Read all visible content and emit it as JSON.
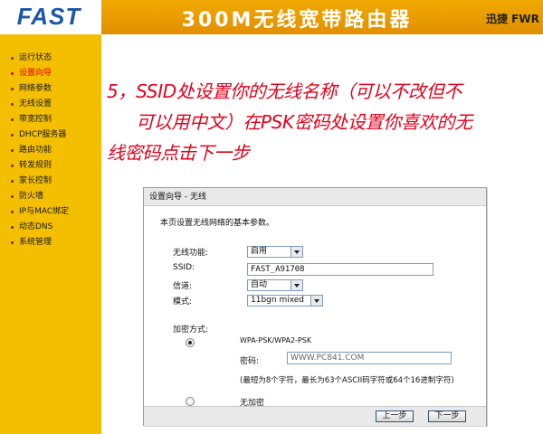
{
  "header": {
    "logo_text": "FAST",
    "router_title": "300M无线宽带路由器",
    "brand_slogan": "迅捷 FWR"
  },
  "sidebar": {
    "items": [
      {
        "label": "运行状态",
        "active": false
      },
      {
        "label": "设置向导",
        "active": true
      },
      {
        "label": "网络参数",
        "active": false
      },
      {
        "label": "无线设置",
        "active": false
      },
      {
        "label": "带宽控制",
        "active": false
      },
      {
        "label": "DHCP服务器",
        "active": false
      },
      {
        "label": "路由功能",
        "active": false
      },
      {
        "label": "转发规则",
        "active": false
      },
      {
        "label": "家长控制",
        "active": false
      },
      {
        "label": "防火墙",
        "active": false
      },
      {
        "label": "IP与MAC绑定",
        "active": false
      },
      {
        "label": "动态DNS",
        "active": false
      },
      {
        "label": "系统管理",
        "active": false
      }
    ]
  },
  "instruction": {
    "line1": "5，SSID处设置你的无线名称（可以不改但不",
    "line2": "可以用中文）在PSK密码处设置你喜欢的无",
    "line3": "线密码点击下一步"
  },
  "dialog": {
    "title": "设置向导 - 无线",
    "description": "本页设置无线网络的基本参数。",
    "wireless_function": {
      "label": "无线功能:",
      "value": "启用"
    },
    "ssid": {
      "label": "SSID:",
      "value": "FAST_A91708"
    },
    "channel": {
      "label": "信道:",
      "value": "自动"
    },
    "mode": {
      "label": "模式:",
      "value": "11bgn mixed"
    },
    "encryption": {
      "label": "加密方式:",
      "wpa_option": "WPA-PSK/WPA2-PSK",
      "wpa_selected": true,
      "password_label": "密码:",
      "password_value": "WWW.PC841.COM",
      "hint": "(最短为8个字符，最长为63个ASCII码字符或64个16进制字符)",
      "no_encryption_option": "无加密",
      "no_encryption_selected": false
    },
    "buttons": {
      "prev_label": "上一步",
      "next_label": "下一步"
    }
  },
  "colors": {
    "sidebar_bg": "#f4bf00",
    "header_band": "#f0a900",
    "logo_blue": "#1b57a7",
    "instruction_red": "#e3001b",
    "active_item_red": "#e60000"
  }
}
